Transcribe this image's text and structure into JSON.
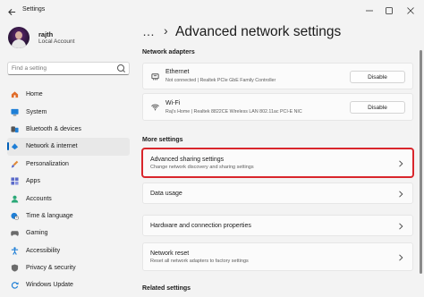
{
  "window": {
    "app_title": "Settings",
    "back_icon": "arrow-left-icon",
    "controls": [
      "minimize-icon",
      "maximize-icon",
      "close-icon"
    ]
  },
  "user": {
    "name": "rajth",
    "account": "Local Account"
  },
  "search": {
    "placeholder": "Find a setting"
  },
  "sidebar": {
    "items": [
      {
        "label": "Home",
        "icon": "home-icon",
        "color": "#e06c2a",
        "active": false
      },
      {
        "label": "System",
        "icon": "monitor-icon",
        "color": "#1f7fd6",
        "active": false
      },
      {
        "label": "Bluetooth & devices",
        "icon": "bluetooth-icon",
        "color": "#1f7fd6",
        "active": false
      },
      {
        "label": "Network & internet",
        "icon": "wifi-icon",
        "color": "#1f7fd6",
        "active": true
      },
      {
        "label": "Personalization",
        "icon": "brush-icon",
        "color": "#e08a3a",
        "active": false
      },
      {
        "label": "Apps",
        "icon": "apps-icon",
        "color": "#5b6ac9",
        "active": false
      },
      {
        "label": "Accounts",
        "icon": "person-icon",
        "color": "#2aa877",
        "active": false
      },
      {
        "label": "Time & language",
        "icon": "globe-clock-icon",
        "color": "#1f7fd6",
        "active": false
      },
      {
        "label": "Gaming",
        "icon": "gamepad-icon",
        "color": "#6b6b6b",
        "active": false
      },
      {
        "label": "Accessibility",
        "icon": "accessibility-icon",
        "color": "#1f7fd6",
        "active": false
      },
      {
        "label": "Privacy & security",
        "icon": "shield-icon",
        "color": "#6b6b6b",
        "active": false
      },
      {
        "label": "Windows Update",
        "icon": "refresh-icon",
        "color": "#1f7fd6",
        "active": false
      }
    ]
  },
  "breadcrumb": {
    "overflow": "…",
    "separator": "›"
  },
  "page_title": "Advanced network settings",
  "adapters": {
    "heading": "Network adapters",
    "items": [
      {
        "name": "Ethernet",
        "detail": "Not connected | Realtek PCIe GbE Family Controller",
        "button": "Disable",
        "icon": "ethernet-icon"
      },
      {
        "name": "Wi-Fi",
        "detail": "Raj's Home | Realtek 8822CE Wireless LAN 802.11ac PCI-E NIC",
        "button": "Disable",
        "icon": "wifi-icon"
      }
    ]
  },
  "more": {
    "heading": "More settings",
    "items": [
      {
        "title": "Advanced sharing settings",
        "sub": "Change network discovery and sharing settings"
      },
      {
        "title": "Data usage",
        "sub": ""
      },
      {
        "title": "Hardware and connection properties",
        "sub": ""
      },
      {
        "title": "Network reset",
        "sub": "Reset all network adapters to factory settings"
      }
    ]
  },
  "related": {
    "heading": "Related settings"
  },
  "highlight_color": "#d9262c",
  "accent_color": "#005fb8"
}
